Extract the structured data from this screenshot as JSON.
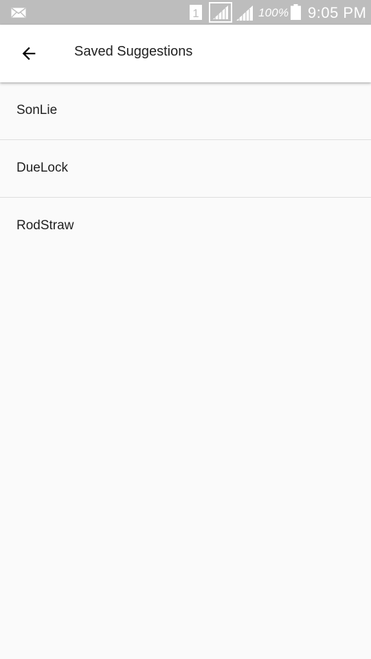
{
  "status_bar": {
    "sim_slot": "1",
    "battery": "100%",
    "time": "9:05 PM",
    "icons": [
      "mail-icon",
      "sim-icon",
      "signal-icon",
      "signal-icon",
      "battery-icon"
    ]
  },
  "app_bar": {
    "title": "Saved Suggestions",
    "back_icon": "arrow-back-icon"
  },
  "saved_list": {
    "items": [
      {
        "label": "SonLie"
      },
      {
        "label": "DueLock"
      },
      {
        "label": "RodStraw"
      }
    ]
  },
  "colors": {
    "status_bar": "#bdbdbd",
    "app_bar": "#ffffff",
    "background": "#fafafa",
    "text": "#212121",
    "divider": "#dedede"
  }
}
